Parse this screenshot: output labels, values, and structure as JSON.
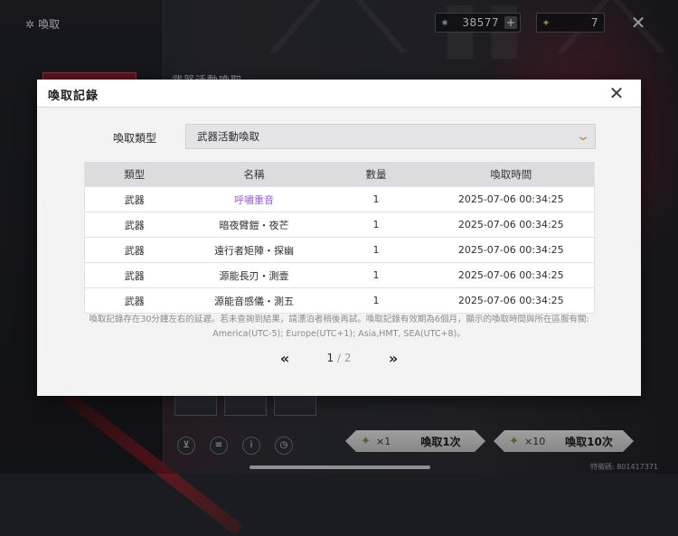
{
  "topbar": {
    "title": "喚取",
    "currency_primary": "38577",
    "currency_secondary": "7"
  },
  "background": {
    "event_title": "武器活動喚取"
  },
  "modal": {
    "title": "喚取記錄",
    "filter_label": "喚取類型",
    "filter_value": "武器活動喚取",
    "columns": [
      "類型",
      "名稱",
      "數量",
      "喚取時間"
    ],
    "rows": [
      {
        "type": "武器",
        "name": "呼嘯重音",
        "qty": "1",
        "time": "2025-07-06 00:34:25"
      },
      {
        "type": "武器",
        "name": "暗夜臂鎧・夜芒",
        "qty": "1",
        "time": "2025-07-06 00:34:25"
      },
      {
        "type": "武器",
        "name": "遠行者矩陣・探幽",
        "qty": "1",
        "time": "2025-07-06 00:34:25"
      },
      {
        "type": "武器",
        "name": "源能長刃・測壹",
        "qty": "1",
        "time": "2025-07-06 00:34:25"
      },
      {
        "type": "武器",
        "name": "源能音感儀・測五",
        "qty": "1",
        "time": "2025-07-06 00:34:25"
      }
    ],
    "note_line1": "喚取記錄存在30分鐘左右的延遲。若未查詢到結果，請漂泊者稍後再試。喚取記錄有效期為6個月，顯示的喚取時間與所在區服有關:",
    "note_line2": "America(UTC-5); Europe(UTC+1); Asia,HMT, SEA(UTC+8)。",
    "pager": {
      "current": "1",
      "separator": "/",
      "total": "2"
    }
  },
  "bottom": {
    "pull_one_count": "×1",
    "pull_one_label": "喚取1次",
    "pull_ten_count": "×10",
    "pull_ten_label": "喚取10次",
    "uid": "特徵碼: 801417371"
  },
  "colors": {
    "accent_gold": "#b08a3a",
    "rare_item": "#9a5bc4"
  }
}
